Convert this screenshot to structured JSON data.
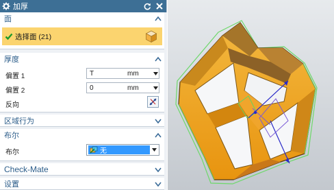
{
  "dialog": {
    "title": "加厚",
    "colors": {
      "title_bar": "#3d6f95",
      "header_text": "#2c5d8a",
      "selection_highlight": "#fbd46f"
    }
  },
  "sections": {
    "face": {
      "title": "面",
      "select_label": "选择面 (21)",
      "expanded": true
    },
    "thickness": {
      "title": "厚度",
      "expanded": true,
      "offset1": {
        "label": "偏置 1",
        "value": "T",
        "unit": "mm"
      },
      "offset2": {
        "label": "偏置 2",
        "value": "0",
        "unit": "mm"
      },
      "reverse_label": "反向"
    },
    "region": {
      "title": "区域行为",
      "expanded": false
    },
    "boolean": {
      "title": "布尔",
      "expanded": true,
      "label": "布尔",
      "value": "无"
    },
    "checkmate": {
      "title": "Check-Mate",
      "expanded": false
    },
    "settings": {
      "title": "设置",
      "expanded": false
    }
  },
  "icons": [
    "gear-icon",
    "reset-icon",
    "close-icon",
    "checkmark-icon",
    "cube-select-icon",
    "chevron-down-icon",
    "reverse-direction-icon",
    "boolean-none-icon"
  ]
}
